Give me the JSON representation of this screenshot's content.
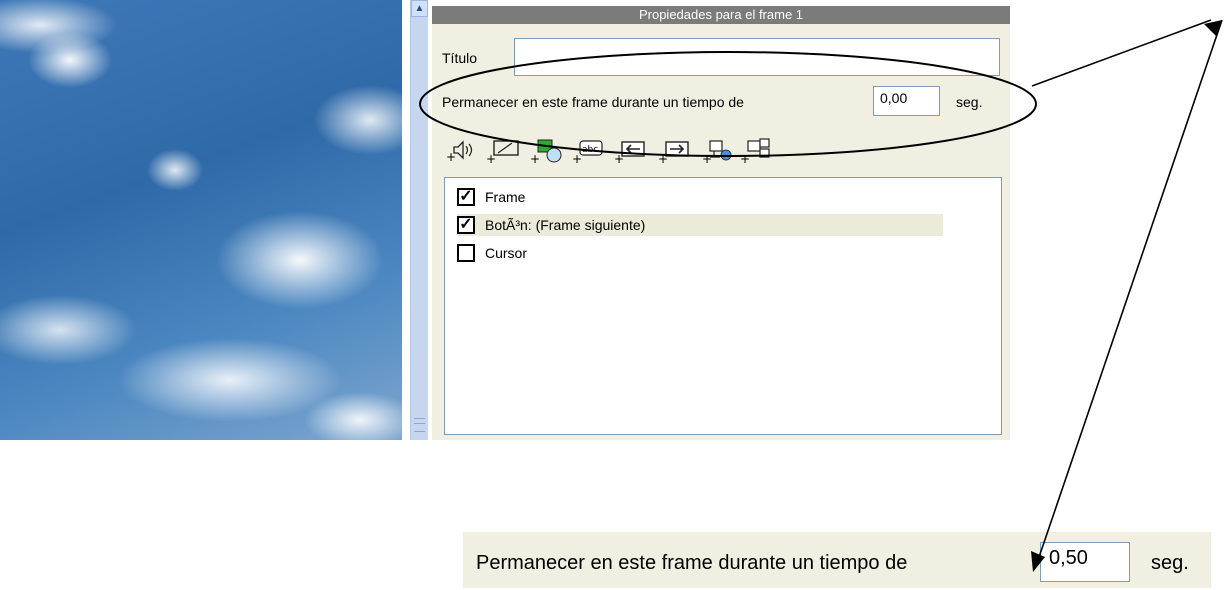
{
  "panel": {
    "title": "Propiedades para el frame 1",
    "titulo_label": "Título",
    "titulo_value": "",
    "permanecer_label": "Permanecer en este frame durante un tiempo de",
    "time_value": "0,00",
    "seg_label": "seg."
  },
  "toolbar": {
    "buttons": [
      {
        "icon": "add-sound-icon"
      },
      {
        "icon": "add-image-icon"
      },
      {
        "icon": "add-shape-icon"
      },
      {
        "icon": "add-text-icon"
      },
      {
        "icon": "add-back-button-icon"
      },
      {
        "icon": "add-next-button-icon"
      },
      {
        "icon": "add-link-icon"
      },
      {
        "icon": "add-frame-icon"
      }
    ]
  },
  "list": {
    "items": [
      {
        "label": "Frame",
        "checked": true
      },
      {
        "label": "BotÃ³n: (Frame siguiente)",
        "checked": true
      },
      {
        "label": "Cursor",
        "checked": false
      }
    ]
  },
  "zoom_callout": {
    "label": "Permanecer en este frame durante un tiempo de",
    "time_value": "0,50",
    "seg_label": "seg."
  }
}
